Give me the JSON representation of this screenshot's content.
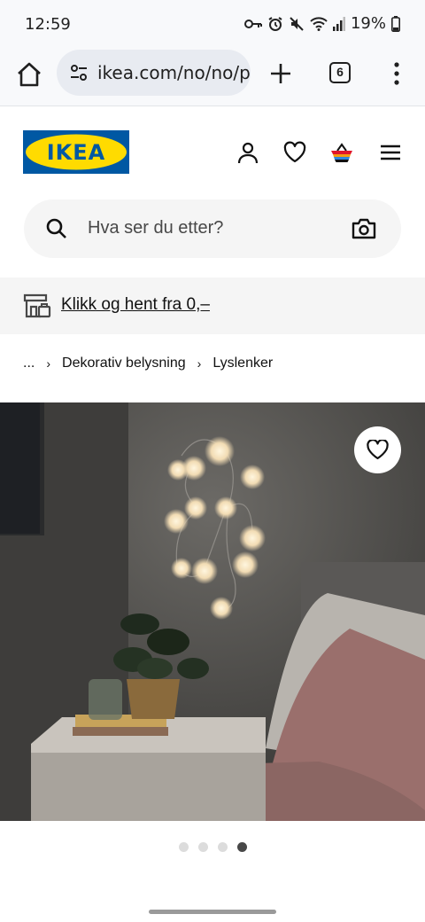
{
  "status_bar": {
    "time": "12:59",
    "battery": "19%",
    "icons": [
      "key-icon",
      "alarm-icon",
      "mute-icon",
      "wifi-icon",
      "signal-icon",
      "battery-icon"
    ]
  },
  "browser": {
    "url": "ikea.com/no/no/p",
    "tab_count": "6",
    "icons": [
      "home-icon",
      "site-settings-icon",
      "new-tab-icon",
      "tabs-icon",
      "more-menu-icon"
    ]
  },
  "ikea": {
    "logo_text": "IKEA",
    "header_icons": [
      "user-icon",
      "heart-icon",
      "basket-icon",
      "hamburger-menu-icon"
    ],
    "search": {
      "placeholder": "Hva ser du etter?"
    },
    "banner": {
      "text": "Klikk og hent fra 0,–"
    },
    "breadcrumb": [
      "...",
      "Dekorativ belysning",
      "Lyslenker"
    ]
  },
  "carousel": {
    "slide_count": 4,
    "active_index": 3
  },
  "colors": {
    "ikea_blue": "#0058a3",
    "ikea_yellow": "#ffdb00",
    "toolbar_bg": "#f8f9fb",
    "search_bg": "#f5f5f5"
  }
}
